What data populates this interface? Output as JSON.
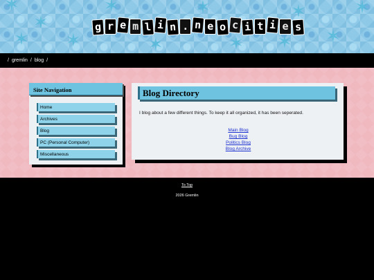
{
  "site": {
    "logo_letters": [
      "g",
      "r",
      "e",
      "m",
      "l",
      "i",
      "n",
      ".",
      "n",
      "e",
      "o",
      "c",
      "i",
      "t",
      "i",
      "e",
      "s"
    ]
  },
  "breadcrumb": {
    "sep": "/",
    "items": [
      "gremlin",
      "blog"
    ]
  },
  "sidebar": {
    "title": "Site Navigation",
    "items": [
      {
        "label": "Home"
      },
      {
        "label": "Archives"
      },
      {
        "label": "Blog"
      },
      {
        "label": "PC (Personal Computer)"
      },
      {
        "label": "Miscellaneous"
      }
    ]
  },
  "main": {
    "title": "Blog Directory",
    "intro": "I blog about a few different things. To keep it all organized, it has been seperated.",
    "links": [
      {
        "label": "Main Blog"
      },
      {
        "label": "Bug Blog"
      },
      {
        "label": "Politics Blog"
      },
      {
        "label": "Blog Archive"
      }
    ]
  },
  "footer": {
    "to_top": "To Top",
    "copyright": "2026 Gremlin"
  },
  "colors": {
    "banner_blue": "#8ec9e8",
    "header_blue": "#6ec3e0",
    "pink_band": "#f0b8bf",
    "link_blue": "#1a2fd0",
    "background": "#000000"
  }
}
